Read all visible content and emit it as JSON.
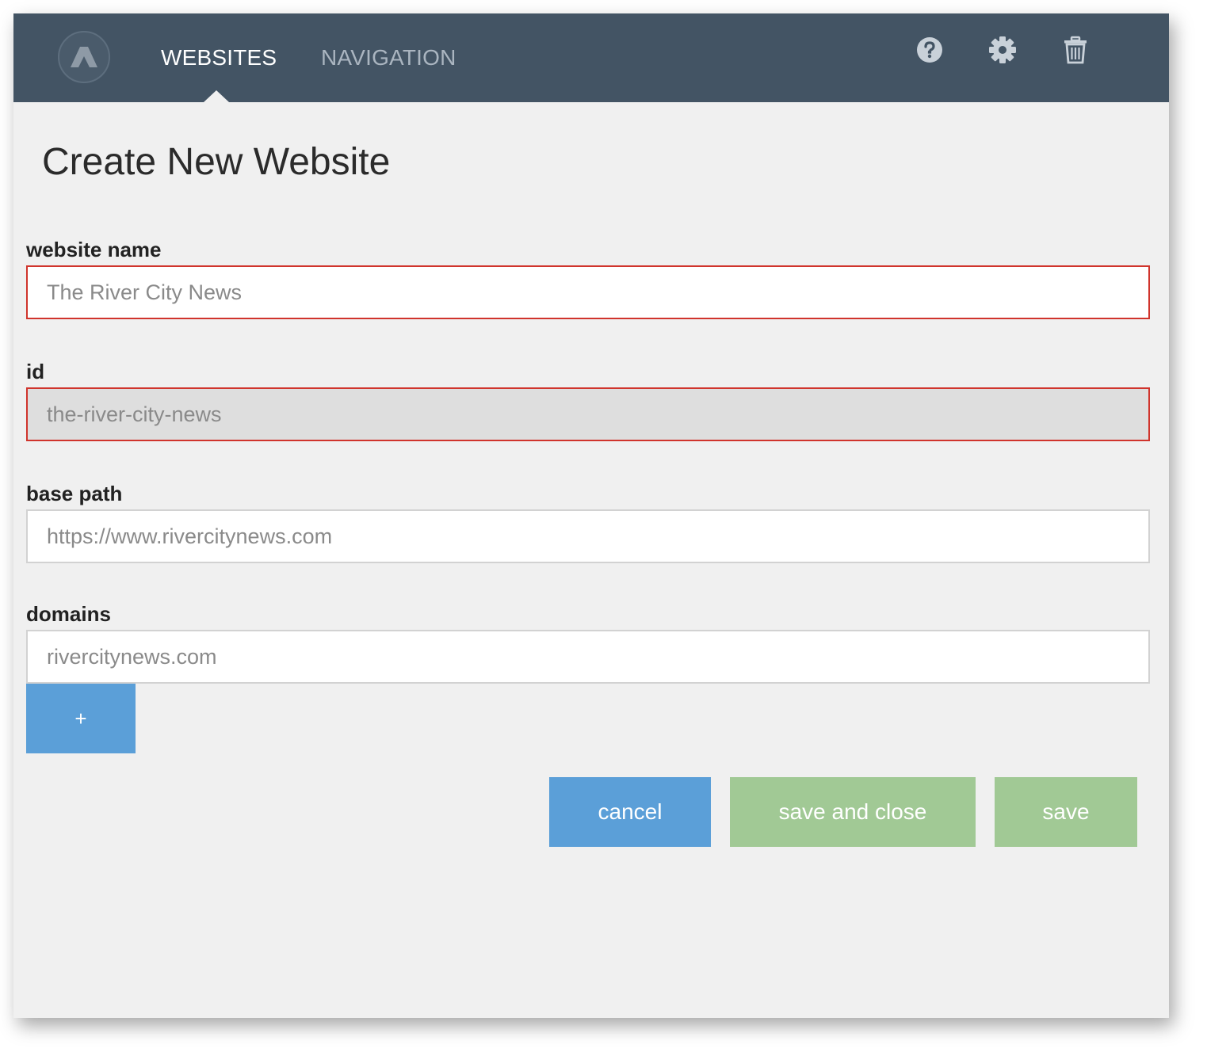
{
  "header": {
    "tabs": [
      {
        "label": "WEBSITES",
        "active": true
      },
      {
        "label": "NAVIGATION",
        "active": false
      }
    ],
    "icons": [
      "help-icon",
      "gear-icon",
      "trash-icon"
    ],
    "colors": {
      "bar": "#435464",
      "active_tab": "#ffffff",
      "inactive_tab": "#aab5c0"
    }
  },
  "page": {
    "title": "Create New Website"
  },
  "form": {
    "website_name": {
      "label": "website name",
      "value": "The River City News",
      "state": "invalid"
    },
    "id": {
      "label": "id",
      "value": "the-river-city-news",
      "state": "invalid, read-only"
    },
    "base_path": {
      "label": "base path",
      "value": "https://www.rivercitynews.com"
    },
    "domains": {
      "label": "domains",
      "value": "rivercitynews.com"
    },
    "add_domain_label": "+"
  },
  "actions": {
    "cancel_label": "cancel",
    "save_and_close_label": "save and close",
    "save_label": "save",
    "colors": {
      "blue": "#5b9fd8",
      "green": "#a1c995",
      "error": "#d0342c"
    }
  }
}
